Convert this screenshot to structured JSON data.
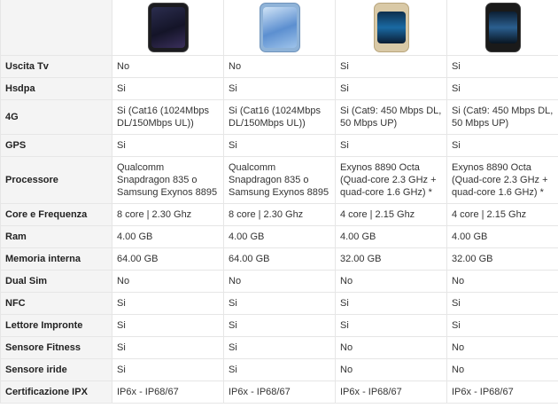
{
  "phones": [
    {
      "icon": "galaxy-s8-black-phone-icon"
    },
    {
      "icon": "galaxy-s8-blue-phone-icon"
    },
    {
      "icon": "galaxy-s7-edge-gold-phone-icon"
    },
    {
      "icon": "galaxy-s7-edge-black-phone-icon"
    }
  ],
  "rows": [
    {
      "label": "Uscita Tv",
      "values": [
        "No",
        "No",
        "Si",
        "Si"
      ]
    },
    {
      "label": "Hsdpa",
      "values": [
        "Si",
        "Si",
        "Si",
        "Si"
      ]
    },
    {
      "label": "4G",
      "values": [
        "Si (Cat16 (1024Mbps DL/150Mbps UL))",
        "Si (Cat16 (1024Mbps DL/150Mbps UL))",
        "Si (Cat9: 450 Mbps DL, 50 Mbps UP)",
        "Si (Cat9: 450 Mbps DL, 50 Mbps UP)"
      ]
    },
    {
      "label": "GPS",
      "values": [
        "Si",
        "Si",
        "Si",
        "Si"
      ]
    },
    {
      "label": "Processore",
      "values": [
        "Qualcomm Snapdragon 835 o Samsung Exynos 8895",
        "Qualcomm Snapdragon 835 o Samsung Exynos 8895",
        "Exynos 8890 Octa (Quad-core 2.3 GHz + quad-core 1.6 GHz) *",
        "Exynos 8890 Octa (Quad-core 2.3 GHz + quad-core 1.6 GHz) *"
      ]
    },
    {
      "label": "Core e Frequenza",
      "values": [
        "8 core | 2.30 Ghz",
        "8 core | 2.30 Ghz",
        "4 core | 2.15 Ghz",
        "4 core | 2.15 Ghz"
      ]
    },
    {
      "label": "Ram",
      "values": [
        "4.00 GB",
        "4.00 GB",
        "4.00 GB",
        "4.00 GB"
      ]
    },
    {
      "label": "Memoria interna",
      "values": [
        "64.00 GB",
        "64.00 GB",
        "32.00 GB",
        "32.00 GB"
      ]
    },
    {
      "label": "Dual Sim",
      "values": [
        "No",
        "No",
        "No",
        "No"
      ]
    },
    {
      "label": "NFC",
      "values": [
        "Si",
        "Si",
        "Si",
        "Si"
      ]
    },
    {
      "label": "Lettore Impronte",
      "values": [
        "Si",
        "Si",
        "Si",
        "Si"
      ]
    },
    {
      "label": "Sensore Fitness",
      "values": [
        "Si",
        "Si",
        "No",
        "No"
      ]
    },
    {
      "label": "Sensore iride",
      "values": [
        "Si",
        "Si",
        "No",
        "No"
      ]
    },
    {
      "label": "Certificazione IPX",
      "values": [
        "IP6x - IP68/67",
        "IP6x - IP68/67",
        "IP6x - IP68/67",
        "IP6x - IP68/67"
      ]
    }
  ],
  "colors": {
    "label_bg": "#f4f4f4",
    "border": "#e6e6e6",
    "text": "#333333"
  }
}
